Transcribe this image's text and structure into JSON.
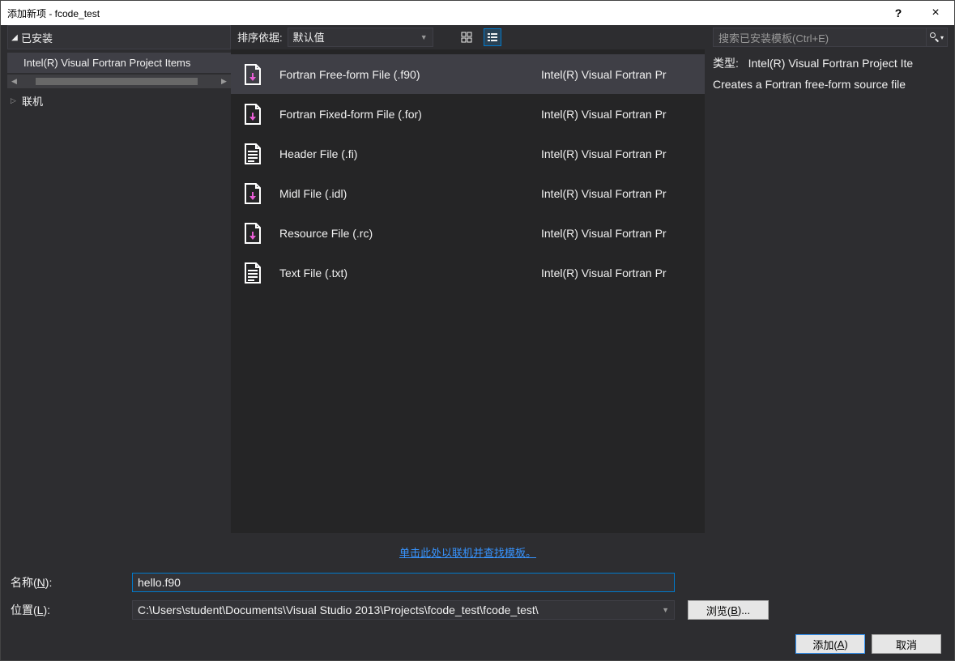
{
  "window": {
    "title": "添加新项 - fcode_test"
  },
  "titlebar": {
    "help": "?",
    "close": "×"
  },
  "sidebar": {
    "installed_label": "已安装",
    "items": [
      "Intel(R) Visual Fortran Project Items"
    ],
    "online_label": "联机"
  },
  "toolbar": {
    "sort_label": "排序依据:",
    "sort_value": "默认值"
  },
  "templates": [
    {
      "name": "Fortran Free-form File (.f90)",
      "category": "Intel(R) Visual Fortran Pr",
      "selected": true,
      "accent": "#e85ed6"
    },
    {
      "name": "Fortran Fixed-form File (.for)",
      "category": "Intel(R) Visual Fortran Pr",
      "selected": false,
      "accent": "#e85ed6"
    },
    {
      "name": "Header File (.fi)",
      "category": "Intel(R) Visual Fortran Pr",
      "selected": false,
      "accent": "#ffffff"
    },
    {
      "name": "Midl File (.idl)",
      "category": "Intel(R) Visual Fortran Pr",
      "selected": false,
      "accent": "#e85ed6"
    },
    {
      "name": "Resource File (.rc)",
      "category": "Intel(R) Visual Fortran Pr",
      "selected": false,
      "accent": "#e85ed6"
    },
    {
      "name": "Text File (.txt)",
      "category": "Intel(R) Visual Fortran Pr",
      "selected": false,
      "accent": "#ffffff"
    }
  ],
  "online_link": "单击此处以联机并查找模板。",
  "search": {
    "placeholder": "搜索已安装模板(Ctrl+E)"
  },
  "info": {
    "type_label": "类型:",
    "type_value": "Intel(R) Visual Fortran Project Ite",
    "description": "Creates a Fortran free-form source file"
  },
  "form": {
    "name_label_pre": "名称(",
    "name_label_u": "N",
    "name_label_post": "):",
    "name_value": "hello.f90",
    "loc_label_pre": "位置(",
    "loc_label_u": "L",
    "loc_label_post": "):",
    "loc_value": "C:\\Users\\student\\Documents\\Visual Studio 2013\\Projects\\fcode_test\\fcode_test\\",
    "browse_pre": "浏览(",
    "browse_u": "B",
    "browse_post": ")..."
  },
  "buttons": {
    "add_pre": "添加(",
    "add_u": "A",
    "add_post": ")",
    "cancel": "取消"
  }
}
